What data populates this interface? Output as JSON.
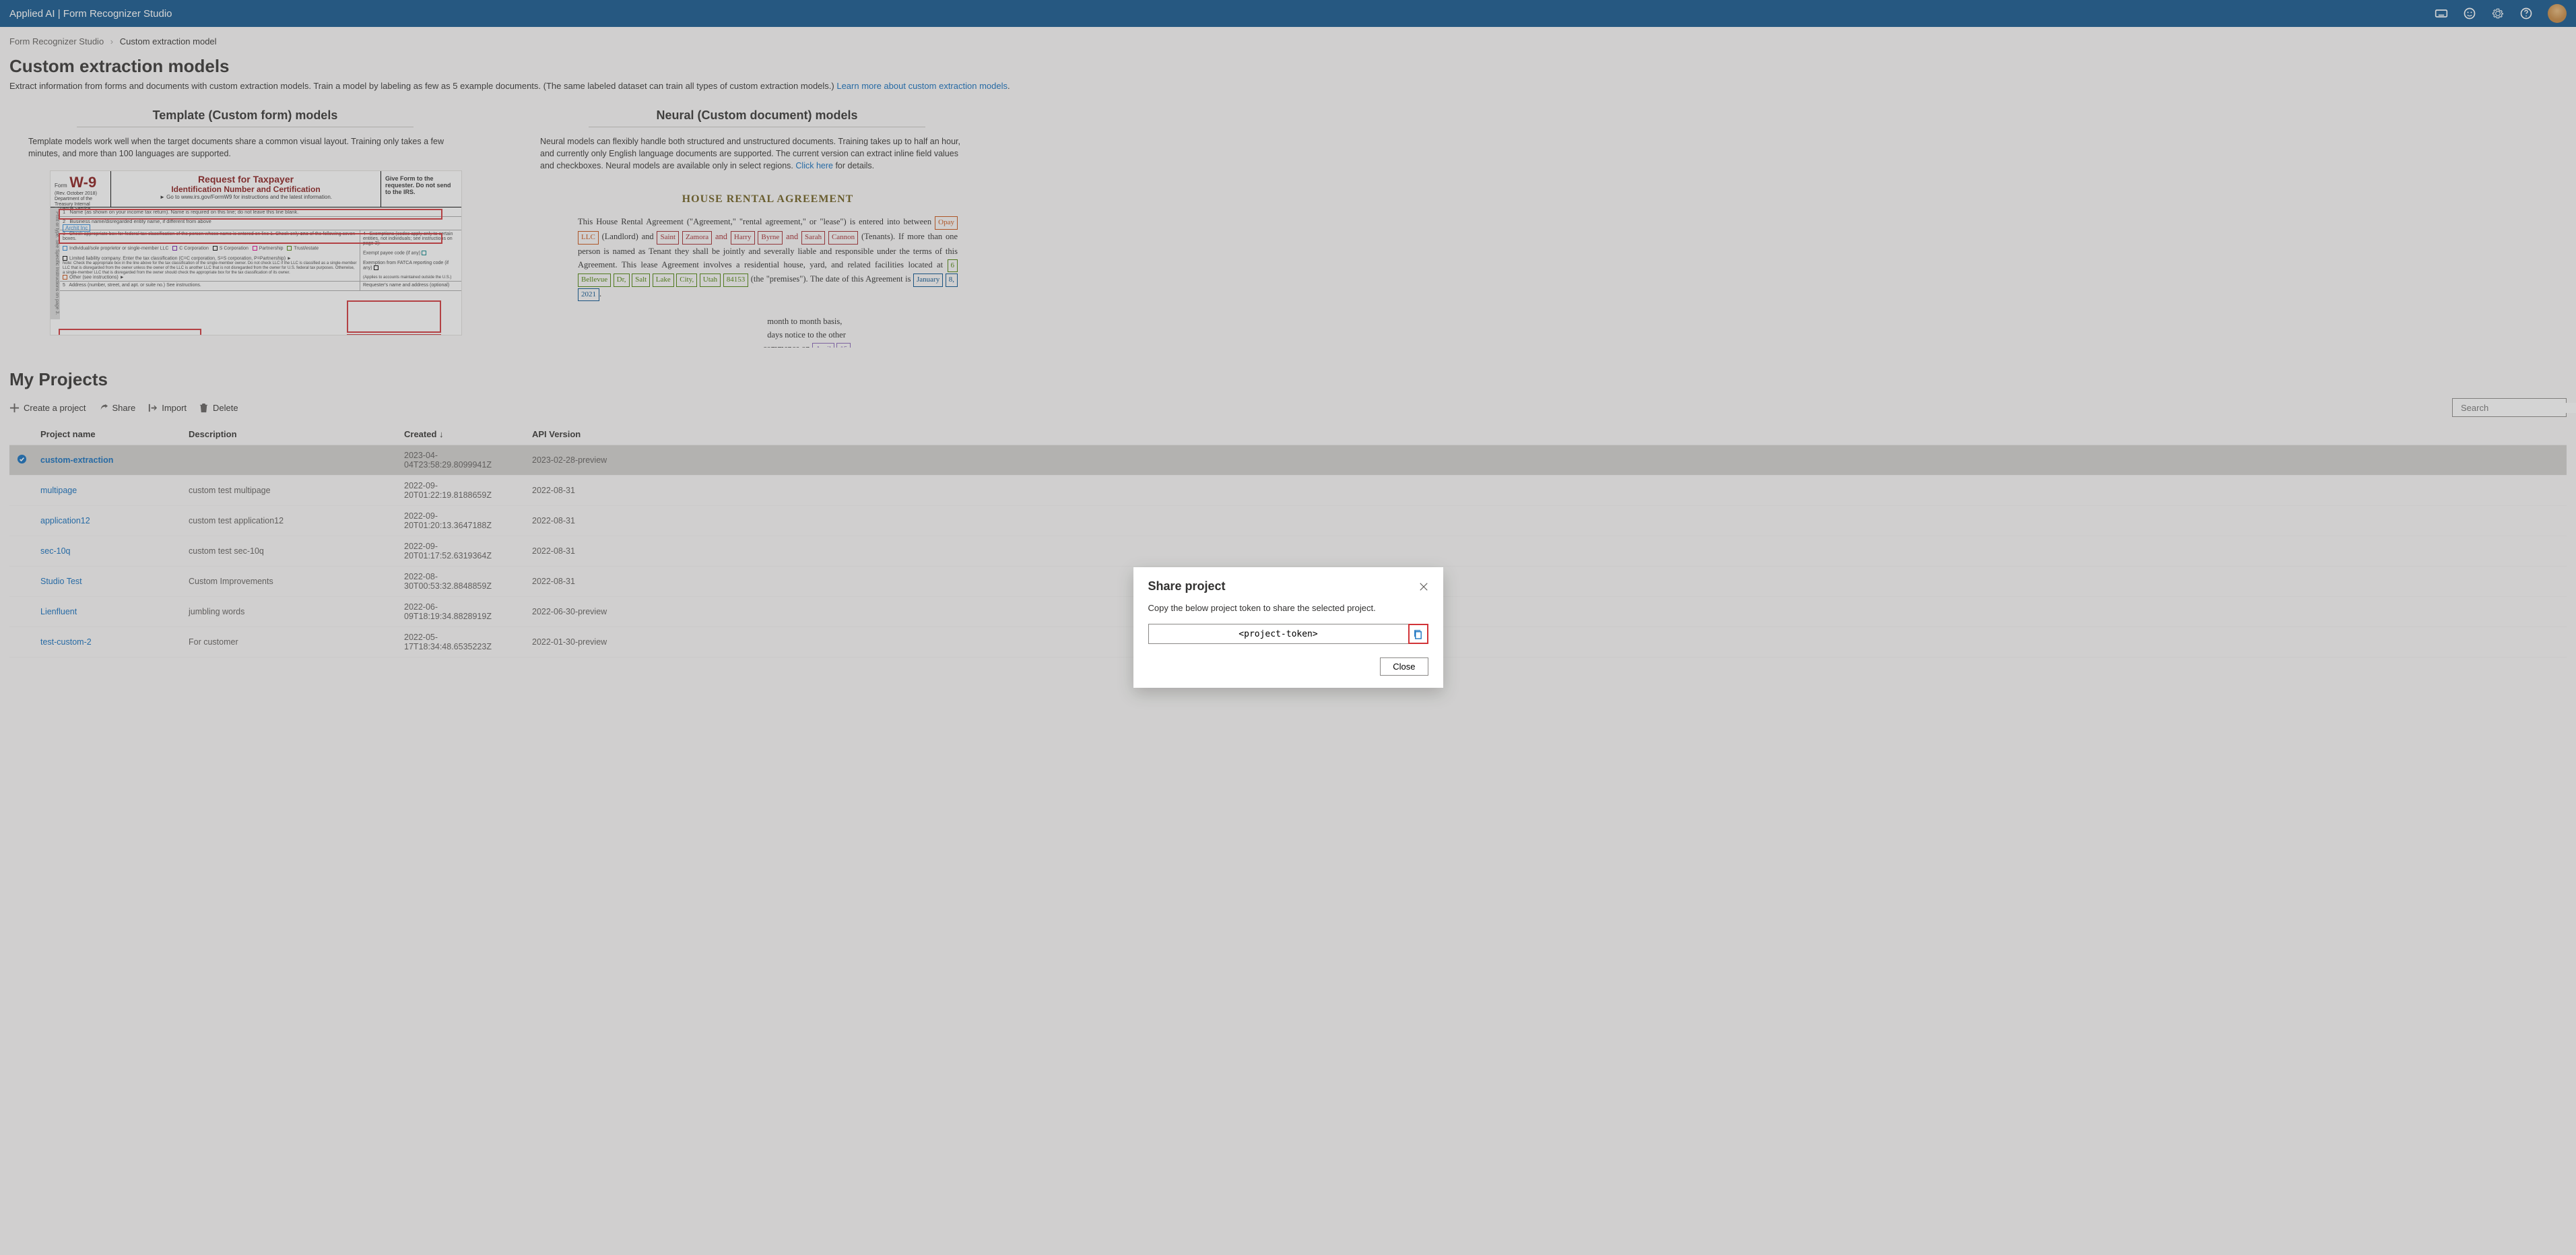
{
  "topbar": {
    "brand": "Applied AI | Form Recognizer Studio"
  },
  "breadcrumbs": {
    "root": "Form Recognizer Studio",
    "current": "Custom extraction model"
  },
  "page": {
    "title": "Custom extraction models",
    "description": "Extract information from forms and documents with custom extraction models. Train a model by labeling as few as 5 example documents. (The same labeled dataset can train all types of custom extraction models.) ",
    "learn_more": "Learn more about custom extraction models"
  },
  "model_types": {
    "template": {
      "heading": "Template (Custom form) models",
      "description": "Template models work well when the target documents share a common visual layout. Training only takes a few minutes, and more than 100 languages are supported."
    },
    "neural": {
      "heading": "Neural (Custom document) models",
      "desc_pre": "Neural models can flexibly handle both structured and unstructured documents. Training takes up to half an hour, and currently only English language documents are supported. The current version can extract inline field values and checkboxes. Neural models are available only in select regions. ",
      "click_here": "Click here",
      "desc_post": " for details."
    }
  },
  "doc_previews": {
    "w9": {
      "form_code": "W-9",
      "rev": "(Rev. October 2018)",
      "dept": "Department of the Treasury Internal Revenue Service",
      "title1": "Request for Taxpayer",
      "title2": "Identification Number and Certification",
      "goto": "► Go to www.irs.gov/FormW9 for instructions and the latest information.",
      "give": "Give Form to the requester. Do not send to the IRS.",
      "tag1": "Archit Inc"
    },
    "rental": {
      "title": "HOUSE RENTAL AGREEMENT"
    }
  },
  "projects": {
    "section_title": "My Projects",
    "toolbar": {
      "create": "Create a project",
      "share": "Share",
      "import": "Import",
      "delete": "Delete",
      "search_placeholder": "Search"
    },
    "columns": {
      "name": "Project name",
      "description": "Description",
      "created": "Created ↓",
      "api": "API Version"
    },
    "rows": [
      {
        "name": "custom-extraction",
        "description": "",
        "created": "2023-04-04T23:58:29.8099941Z",
        "api": "2023-02-28-preview",
        "selected": true
      },
      {
        "name": "multipage",
        "description": "custom test multipage",
        "created": "2022-09-20T01:22:19.8188659Z",
        "api": "2022-08-31"
      },
      {
        "name": "application12",
        "description": "custom test application12",
        "created": "2022-09-20T01:20:13.3647188Z",
        "api": "2022-08-31"
      },
      {
        "name": "sec-10q",
        "description": "custom test sec-10q",
        "created": "2022-09-20T01:17:52.6319364Z",
        "api": "2022-08-31"
      },
      {
        "name": "Studio Test",
        "description": "Custom Improvements",
        "created": "2022-08-30T00:53:32.8848859Z",
        "api": "2022-08-31"
      },
      {
        "name": "Lienfluent",
        "description": "jumbling words",
        "created": "2022-06-09T18:19:34.8828919Z",
        "api": "2022-06-30-preview"
      },
      {
        "name": "test-custom-2",
        "description": "For customer",
        "created": "2022-05-17T18:34:48.6535223Z",
        "api": "2022-01-30-preview"
      }
    ]
  },
  "modal": {
    "title": "Share project",
    "description": "Copy the below project token to share the selected project.",
    "token": "<project-token>",
    "close": "Close"
  }
}
